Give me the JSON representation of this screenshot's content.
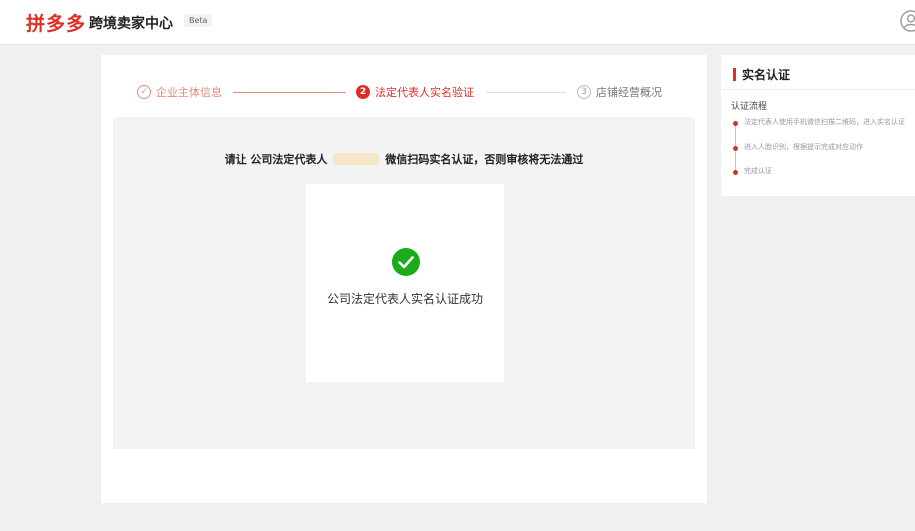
{
  "header": {
    "brand": "拼多多",
    "app_title": "跨境卖家中心",
    "badge": "Beta"
  },
  "steps": [
    {
      "number": "1",
      "label": "企业主体信息",
      "state": "done"
    },
    {
      "number": "2",
      "label": "法定代表人实名验证",
      "state": "active"
    },
    {
      "number": "3",
      "label": "店铺经营概况",
      "state": "pending"
    }
  ],
  "verify": {
    "instruction_prefix": "请让 公司法定代表人",
    "instruction_suffix": "微信扫码实名认证，否则审核将无法通过",
    "success_text": "公司法定代表人实名认证成功"
  },
  "side": {
    "title": "实名认证",
    "flow_title": "认证流程",
    "flow_items": [
      "法定代表人使用手机微信扫描二维码，进入实名认证",
      "进入人脸识别，根据提示完成对应动作",
      "完成认证"
    ]
  },
  "colors": {
    "brand": "#e02e24",
    "success": "#1aad19",
    "done_step": "#e5897f"
  }
}
